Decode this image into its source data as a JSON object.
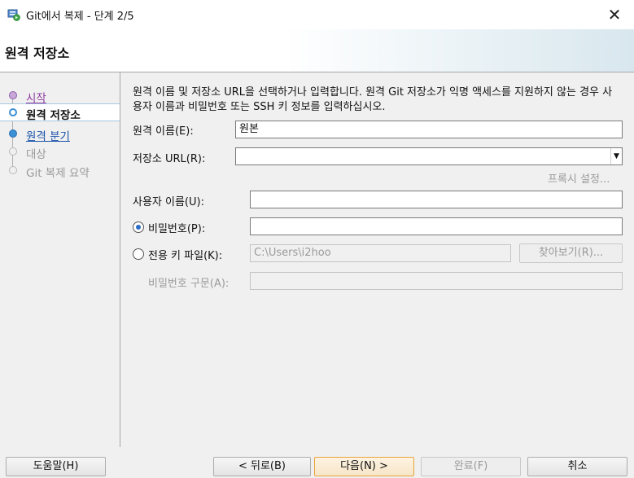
{
  "window": {
    "title": "Git에서 복제 - 단계 2/5",
    "icon": "git-clone-app-icon",
    "close_glyph": "✕"
  },
  "banner": {
    "title": "원격 저장소"
  },
  "nav": {
    "items": [
      {
        "label": "시작",
        "state": "visited"
      },
      {
        "label": "원격 저장소",
        "state": "current"
      },
      {
        "label": "원격 분기",
        "state": "link"
      },
      {
        "label": "대상",
        "state": "disabled"
      },
      {
        "label": "Git 복제 요약",
        "state": "disabled"
      }
    ]
  },
  "form": {
    "description": "원격 이름 및 저장소 URL을 선택하거나 입력합니다. 원격 Git 저장소가 익명 액세스를 지원하지 않는 경우 사용자 이름과 비밀번호 또는 SSH 키 정보를 입력하십시오.",
    "remote_name_label": "원격 이름(E):",
    "remote_name_value": "원본",
    "repo_url_label": "저장소 URL(R):",
    "repo_url_value": "",
    "proxy_link": "프록시 설정...",
    "username_label": "사용자 이름(U):",
    "username_value": "",
    "password_label": "비밀번호(P):",
    "password_value": "",
    "password_selected": true,
    "keyfile_label": "전용 키 파일(K):",
    "keyfile_value": "C:\\Users\\i2hoo",
    "keyfile_selected": false,
    "browse_label": "찾아보기(R)...",
    "passphrase_label": "비밀번호 구문(A):",
    "passphrase_value": ""
  },
  "footer": {
    "help_label": "도움말(H)",
    "back_label": "< 뒤로(B)",
    "next_label": "다음(N) >",
    "finish_label": "완료(F)",
    "cancel_label": "취소"
  },
  "colors": {
    "accent": "#3a8fd6",
    "visited_link": "#8e3aa0",
    "link": "#1a52a8",
    "disabled_text": "#9a9a9a",
    "default_button_border": "#e8a33d"
  }
}
